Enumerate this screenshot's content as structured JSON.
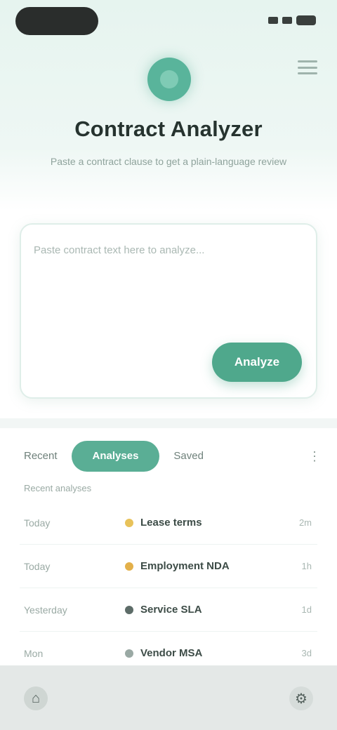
{
  "header": {
    "title": "Contract Analyzer",
    "subtitle": "Paste a contract clause to get a plain-language review"
  },
  "composer": {
    "placeholder": "Paste contract text here to analyze...",
    "value": "",
    "submit_label": "Analyze"
  },
  "tabs": [
    {
      "label": "Recent"
    },
    {
      "label": "Analyses"
    },
    {
      "label": "Saved"
    }
  ],
  "tab_more_icon": "more-icon",
  "section_label": "Recent analyses",
  "items": [
    {
      "left": "Today",
      "name": "Lease terms",
      "right": "2m",
      "dot_color": "#e8c25a"
    },
    {
      "left": "Today",
      "name": "Employment NDA",
      "right": "1h",
      "dot_color": "#e3b04a"
    },
    {
      "left": "Yesterday",
      "name": "Service SLA",
      "right": "1d",
      "dot_color": "#5d6c68"
    },
    {
      "left": "Mon",
      "name": "Vendor MSA",
      "right": "3d",
      "dot_color": "#9aa9a4"
    }
  ],
  "colors": {
    "accent": "#4fa88c",
    "header_bg": "#e6f4ef"
  },
  "bottom_nav": {
    "left_icon": "home-icon",
    "right_icon": "settings-icon"
  }
}
